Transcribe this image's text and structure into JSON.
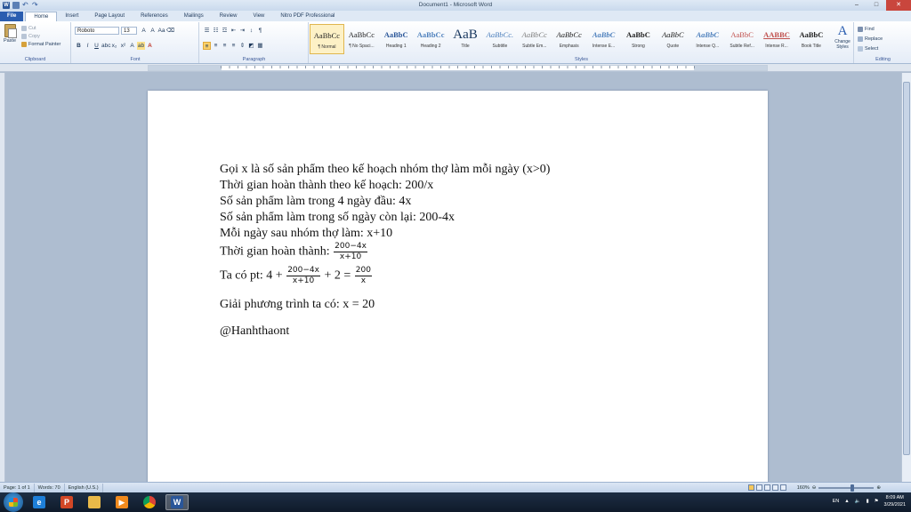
{
  "window": {
    "title": "Document1 - Microsoft Word"
  },
  "tabs": [
    "File",
    "Home",
    "Insert",
    "Page Layout",
    "References",
    "Mailings",
    "Review",
    "View",
    "Nitro PDF Professional"
  ],
  "clipboard": {
    "paste": "Paste",
    "cut": "Cut",
    "copy": "Copy",
    "format_painter": "Format Painter",
    "label": "Clipboard"
  },
  "font": {
    "name": "Roboto",
    "size": "13",
    "label": "Font"
  },
  "paragraph": {
    "label": "Paragraph"
  },
  "styles": {
    "label": "Styles",
    "items": [
      {
        "sample": "AaBbCc",
        "name": "¶ Normal"
      },
      {
        "sample": "AaBbCc",
        "name": "¶ No Spaci..."
      },
      {
        "sample": "AaBbC",
        "name": "Heading 1"
      },
      {
        "sample": "AaBbCc",
        "name": "Heading 2"
      },
      {
        "sample": "AaB",
        "name": "Title"
      },
      {
        "sample": "AaBbCc.",
        "name": "Subtitle"
      },
      {
        "sample": "AaBbCc",
        "name": "Subtle Em..."
      },
      {
        "sample": "AaBbCc",
        "name": "Emphasis"
      },
      {
        "sample": "AaBbC",
        "name": "Intense E..."
      },
      {
        "sample": "AaBbC",
        "name": "Strong"
      },
      {
        "sample": "AaBbC",
        "name": "Quote"
      },
      {
        "sample": "AaBbC",
        "name": "Intense Q..."
      },
      {
        "sample": "AaBbC",
        "name": "Subtle Ref..."
      },
      {
        "sample": "AABBC",
        "name": "Intense R..."
      },
      {
        "sample": "AaBbC",
        "name": "Book Title"
      }
    ],
    "change_styles": "Change Styles"
  },
  "editing": {
    "label": "Editing",
    "find": "Find",
    "replace": "Replace",
    "select": "Select"
  },
  "document": {
    "line1": "Gọi x là số sản phẩm theo kế hoạch nhóm thợ làm mỗi ngày (x>0)",
    "line2": "Thời gian hoàn thành theo kế hoạch: 200/x",
    "line3": "Số sản phẩm làm trong 4 ngày đầu: 4x",
    "line4": "Số sản phẩm làm trong số ngày còn lại: 200-4x",
    "line5": "Mỗi ngày sau nhóm thợ làm: x+10",
    "line6_prefix": "Thời gian hoàn thành: ",
    "frac1_num": "200−4x",
    "frac1_den": "x+10",
    "eq_prefix": "Ta có pt: 4 + ",
    "eq_frac_num": "200−4x",
    "eq_frac_den": "x+10",
    "eq_middle": " + 2 = ",
    "eq_rhs_num": "200",
    "eq_rhs_den": "x",
    "solve": "Giải phương trình ta có: x = 20",
    "signature": "@Hanhthaont"
  },
  "status": {
    "page": "Page: 1 of 1",
    "words": "Words: 70",
    "language": "English (U.S.)",
    "zoom": "160%"
  },
  "taskbar": {
    "lang": "EN",
    "time": "8:09 AM",
    "date": "3/29/2021"
  }
}
